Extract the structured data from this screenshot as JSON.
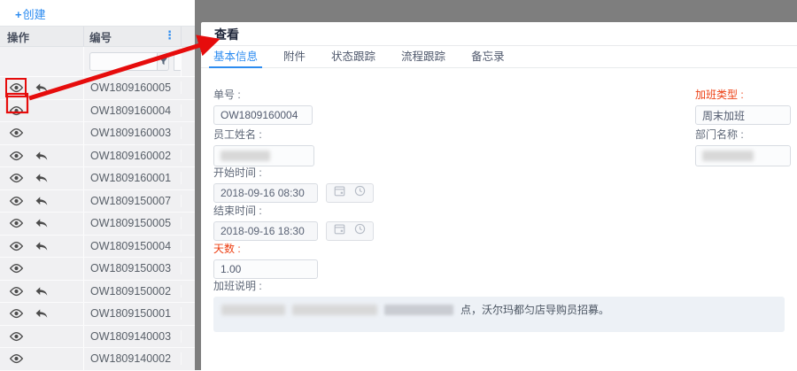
{
  "toolbar": {
    "create_icon": "+",
    "create_label": "创建"
  },
  "table": {
    "header": {
      "actions": "操作",
      "number": "编号",
      "menu_icon": "⋮"
    },
    "rows": [
      {
        "number": "OW1809160005",
        "has_undo": true,
        "highlighted": true
      },
      {
        "number": "OW1809160004",
        "has_undo": false,
        "highlighted": false
      },
      {
        "number": "OW1809160003",
        "has_undo": false,
        "highlighted": false
      },
      {
        "number": "OW1809160002",
        "has_undo": true,
        "highlighted": false
      },
      {
        "number": "OW1809160001",
        "has_undo": true,
        "highlighted": false
      },
      {
        "number": "OW1809150007",
        "has_undo": true,
        "highlighted": false
      },
      {
        "number": "OW1809150005",
        "has_undo": true,
        "highlighted": false
      },
      {
        "number": "OW1809150004",
        "has_undo": true,
        "highlighted": false
      },
      {
        "number": "OW1809150003",
        "has_undo": false,
        "highlighted": false
      },
      {
        "number": "OW1809150002",
        "has_undo": true,
        "highlighted": false
      },
      {
        "number": "OW1809150001",
        "has_undo": true,
        "highlighted": false
      },
      {
        "number": "OW1809140003",
        "has_undo": false,
        "highlighted": false
      },
      {
        "number": "OW1809140002",
        "has_undo": false,
        "highlighted": false
      }
    ]
  },
  "panel": {
    "title": "查看",
    "tabs": [
      {
        "label": "基本信息",
        "active": true
      },
      {
        "label": "附件",
        "active": false
      },
      {
        "label": "状态跟踪",
        "active": false
      },
      {
        "label": "流程跟踪",
        "active": false
      },
      {
        "label": "备忘录",
        "active": false
      }
    ],
    "fields": {
      "order_no": {
        "label": "单号 :",
        "value": "OW1809160004"
      },
      "employee_name": {
        "label": "员工姓名 :",
        "value": "",
        "redacted": true
      },
      "start_time": {
        "label": "开始时间 :",
        "value": "2018-09-16 08:30"
      },
      "end_time": {
        "label": "结束时间 :",
        "value": "2018-09-16 18:30"
      },
      "days": {
        "label": "天数 :",
        "value": "1.00"
      },
      "note": {
        "label": "加班说明 :",
        "visible_text": "点，沃尔玛都匀店导购员招募。",
        "redacted": true
      },
      "overtime_type": {
        "label": "加班类型 :",
        "value": "周末加班"
      },
      "department": {
        "label": "部门名称 :",
        "value": "",
        "redacted": true
      }
    }
  },
  "colors": {
    "accent_blue": "#2d8cf0",
    "required_red": "#ed4014",
    "annotation_red": "#e60c0c",
    "backdrop_gray": "#7e7e7e"
  }
}
